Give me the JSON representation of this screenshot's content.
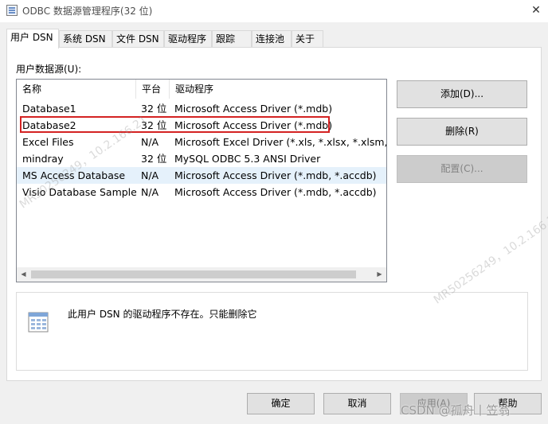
{
  "window": {
    "title": "ODBC 数据源管理程序(32 位)",
    "close_glyph": "✕"
  },
  "tabs": [
    {
      "label": "用户 DSN",
      "active": true
    },
    {
      "label": "系统 DSN"
    },
    {
      "label": "文件 DSN"
    },
    {
      "label": "驱动程序"
    },
    {
      "label": "跟踪"
    },
    {
      "label": "连接池"
    },
    {
      "label": "关于"
    }
  ],
  "user_dsn": {
    "group_label": "用户数据源(U):",
    "columns": [
      "名称",
      "平台",
      "驱动程序"
    ],
    "rows": [
      {
        "name": "Database1",
        "platform": "32 位",
        "driver": "Microsoft Access Driver (*.mdb)"
      },
      {
        "name": "Database2",
        "platform": "32 位",
        "driver": "Microsoft Access Driver (*.mdb)"
      },
      {
        "name": "Excel Files",
        "platform": "N/A",
        "driver": "Microsoft Excel Driver (*.xls, *.xlsx, *.xlsm, *.xlsb)"
      },
      {
        "name": "mindray",
        "platform": "32 位",
        "driver": "MySQL ODBC 5.3 ANSI Driver"
      },
      {
        "name": "MS Access Database",
        "platform": "N/A",
        "driver": "Microsoft Access Driver (*.mdb, *.accdb)"
      },
      {
        "name": "Visio Database Samples",
        "platform": "N/A",
        "driver": "Microsoft Access Driver (*.mdb, *.accdb)"
      }
    ],
    "buttons": {
      "add": "添加(D)...",
      "remove": "删除(R)",
      "configure": "配置(C)..."
    },
    "info_text": "此用户 DSN 的驱动程序不存在。只能删除它"
  },
  "dialog_buttons": {
    "ok": "确定",
    "cancel": "取消",
    "apply": "应用(A)",
    "help": "帮助"
  },
  "watermark": {
    "text": "MR50256249，10.2.166.21",
    "credit": "CSDN @孤舟丨笠翁"
  },
  "colors": {
    "highlight_border": "#d42222",
    "hover_row": "#e5f1fb"
  }
}
